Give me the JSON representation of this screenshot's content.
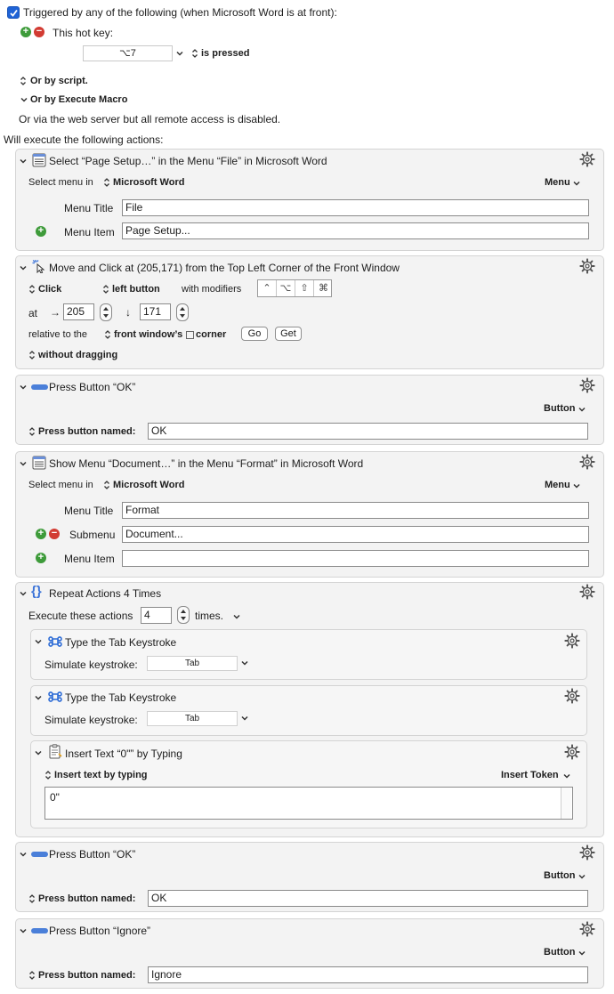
{
  "trigger": {
    "header": "Triggered by any of the following (when Microsoft Word is at front):",
    "hotkey_label": "This hot key:",
    "hotkey_value": "⌥7",
    "is_pressed": "is pressed",
    "or_by_script": "Or by script.",
    "or_by_execute_macro": "Or by Execute Macro",
    "web_server_note": "Or via the web server but all remote access is disabled."
  },
  "actions_header": "Will execute the following actions:",
  "action1": {
    "title": "Select “Page Setup…” in the Menu “File” in Microsoft Word",
    "select_menu_in": "Select menu in",
    "app": "Microsoft Word",
    "menu_popup": "Menu",
    "menu_title_label": "Menu Title",
    "menu_title_value": "File",
    "menu_item_label": "Menu Item",
    "menu_item_value": "Page Setup..."
  },
  "action2": {
    "title": "Move and Click at (205,171) from the Top Left Corner of the Front Window",
    "click": "Click",
    "button": "left button",
    "with_modifiers": "with modifiers",
    "modifiers": [
      "⌃",
      "⌥",
      "⇧",
      "⌘"
    ],
    "at_label": "at",
    "x_value": "205",
    "y_value": "171",
    "relative_label": "relative to the",
    "relative_target": "front window’s",
    "corner": "corner",
    "go": "Go",
    "get": "Get",
    "dragging": "without dragging"
  },
  "action3": {
    "title": "Press Button “OK”",
    "button_popup": "Button",
    "press_label": "Press button named:",
    "value": "OK"
  },
  "action4": {
    "title": "Show Menu “Document…” in the Menu “Format” in Microsoft Word",
    "select_menu_in": "Select menu in",
    "app": "Microsoft Word",
    "menu_popup": "Menu",
    "menu_title_label": "Menu Title",
    "menu_title_value": "Format",
    "submenu_label": "Submenu",
    "submenu_value": "Document...",
    "menu_item_label": "Menu Item",
    "menu_item_value": ""
  },
  "action5": {
    "title": "Repeat Actions 4 Times",
    "execute_label": "Execute these actions",
    "times_value": "4",
    "times_label": "times.",
    "sub1": {
      "title": "Type the Tab Keystroke",
      "simulate": "Simulate keystroke:",
      "key": "Tab"
    },
    "sub2": {
      "title": "Type the Tab Keystroke",
      "simulate": "Simulate keystroke:",
      "key": "Tab"
    },
    "sub3": {
      "title": "Insert Text “0\"” by Typing",
      "mode": "Insert text by typing",
      "token": "Insert Token",
      "text": "0\""
    }
  },
  "action6": {
    "title": "Press Button “OK”",
    "button_popup": "Button",
    "press_label": "Press button named:",
    "value": "OK"
  },
  "action7": {
    "title": "Press Button “Ignore”",
    "button_popup": "Button",
    "press_label": "Press button named:",
    "value": "Ignore"
  },
  "colors": {
    "accent": "#1f63d6",
    "add": "#3e9b3a",
    "remove": "#d23b32",
    "panel": "#f3f3f3",
    "icon_blue": "#3b73d8"
  }
}
